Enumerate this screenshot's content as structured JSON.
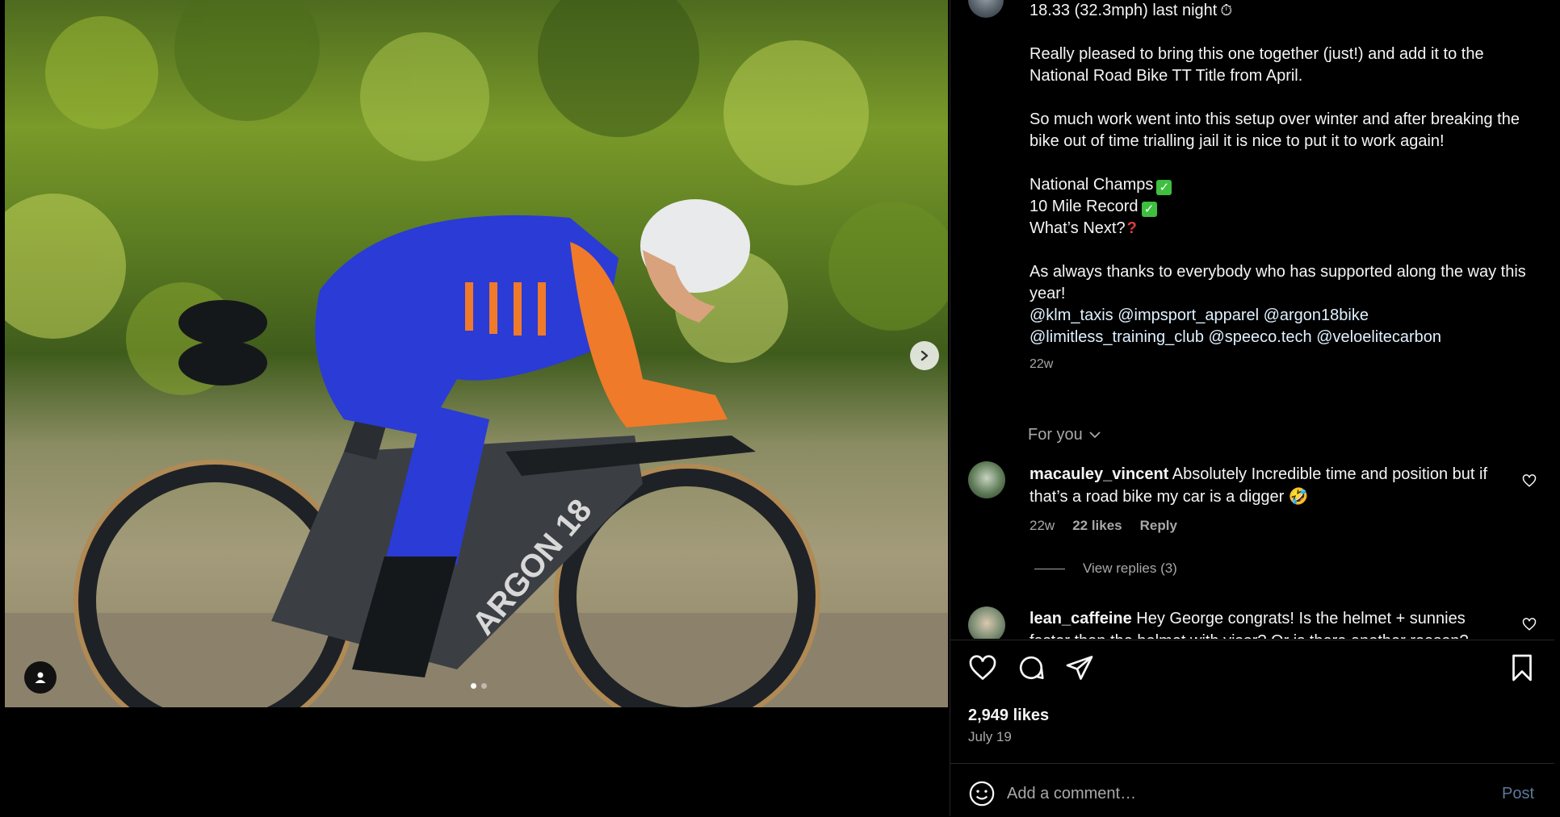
{
  "post": {
    "photo_alt_icons": [
      "chevron-right-icon",
      "user-tag-icon"
    ],
    "carousel_total": 2,
    "carousel_active": 1
  },
  "caption": {
    "line1": "18.33 (32.3mph) last night",
    "line2": "Really pleased to bring this one together (just!) and add it to the National Road Bike TT Title from April.",
    "line3": "So much work went into this setup over winter and after breaking the bike out of time trialling jail it is nice to put it to work again!",
    "line4": "National Champs",
    "line5": "10 Mile Record",
    "line6": "What’s Next?",
    "line7": "As always thanks to everybody who has supported along the way this year!",
    "mentions1": "@klm_taxis @impsport_apparel @argon18bike",
    "mentions2": "@limitless_training_club @speeco.tech @veloelitecarbon",
    "time": "22w"
  },
  "for_you": "For you",
  "comments": [
    {
      "user": "macauley_vincent",
      "text": "Absolutely Incredible time and position but if that’s a road bike my car is a digger 🤣",
      "time": "22w",
      "likes": "22 likes",
      "reply": "Reply",
      "view_replies": "View replies (3)"
    },
    {
      "user": "lean_caffeine",
      "text": "Hey George congrats! Is the helmet + sunnies faster than the helmet with visor? Or is there another reason?"
    }
  ],
  "actions": {
    "likes": "2,949 likes",
    "date": "July 19"
  },
  "add_comment": {
    "placeholder": "Add a comment…",
    "post_label": "Post"
  },
  "colors": {
    "background": "#000000",
    "text": "#f5f5f5",
    "muted": "#a8a8a8",
    "post_button": "#5b7a9a",
    "jersey_blue": "#2b3bd6",
    "sleeve_orange": "#ef7a2a"
  }
}
